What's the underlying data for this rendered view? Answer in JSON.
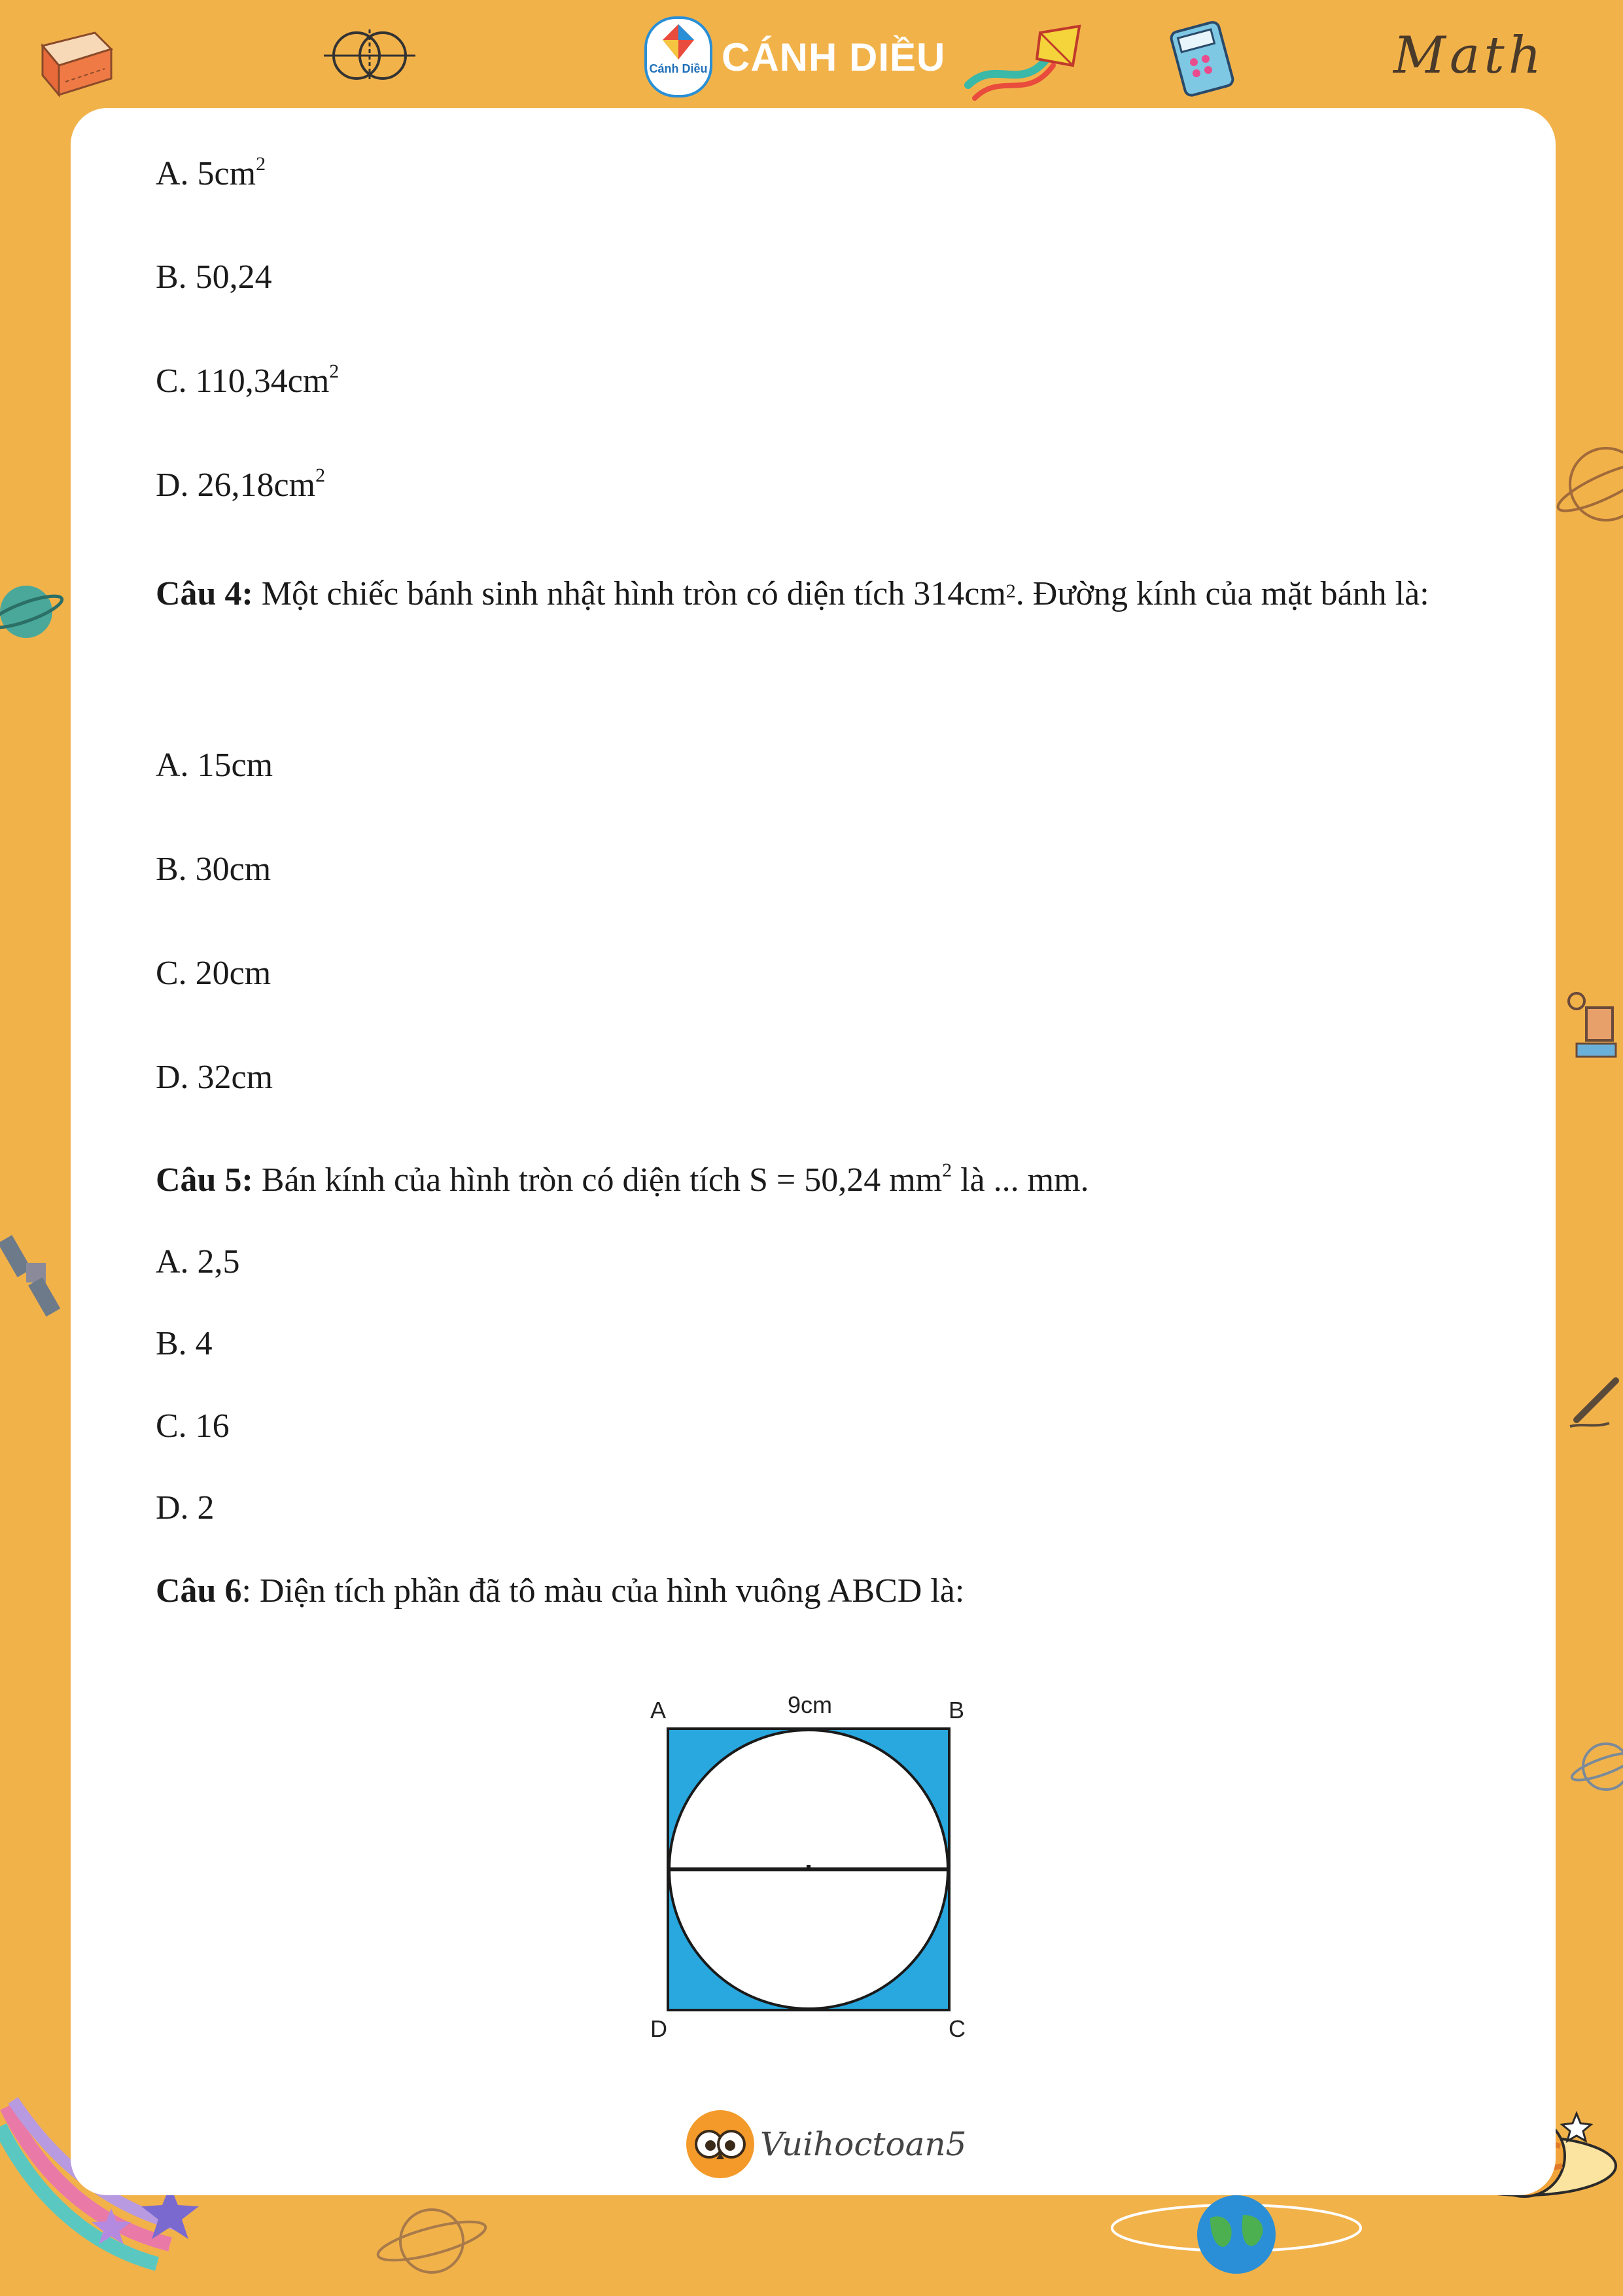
{
  "header": {
    "brand_name": "CÁNH DIỀU",
    "brand_logo_text": "Cánh Diều",
    "math_word": "Math"
  },
  "content": {
    "q3_options": {
      "a": {
        "label": "A. 5cm",
        "sup": "2"
      },
      "b": {
        "label": "B. 50,24"
      },
      "c": {
        "label": "C. 110,34cm",
        "sup": "2"
      },
      "d": {
        "label": "D. 26,18cm",
        "sup": "2"
      }
    },
    "q4": {
      "number": "Câu 4:",
      "text_part1": " Một chiếc bánh sinh nhật hình tròn có diện tích 314cm",
      "sup": "2",
      "text_part2": ". Đường kính của mặt bánh là:",
      "options": [
        "A. 15cm",
        "B. 30cm",
        "C. 20cm",
        "D. 32cm"
      ]
    },
    "q5": {
      "number": "Câu 5:",
      "text_part1": " Bán kính của hình tròn có diện tích S = 50,24 mm",
      "sup": "2",
      "text_part2": " là ... mm.",
      "options": [
        "A. 2,5",
        "B. 4",
        "C. 16",
        "D. 2"
      ]
    },
    "q6": {
      "number": "Câu 6",
      "text": ": Diện tích phần đã tô màu của hình vuông ABCD là:"
    },
    "figure": {
      "label_a": "A",
      "label_b": "B",
      "label_c": "C",
      "label_d": "D",
      "side_label": "9cm",
      "fill_color": "#29a8df",
      "stroke_color": "#1a1a1a"
    }
  },
  "footer": {
    "brand": "Vuihoctoan5"
  },
  "colors": {
    "frame": "#f2b24a",
    "card": "#ffffff"
  }
}
